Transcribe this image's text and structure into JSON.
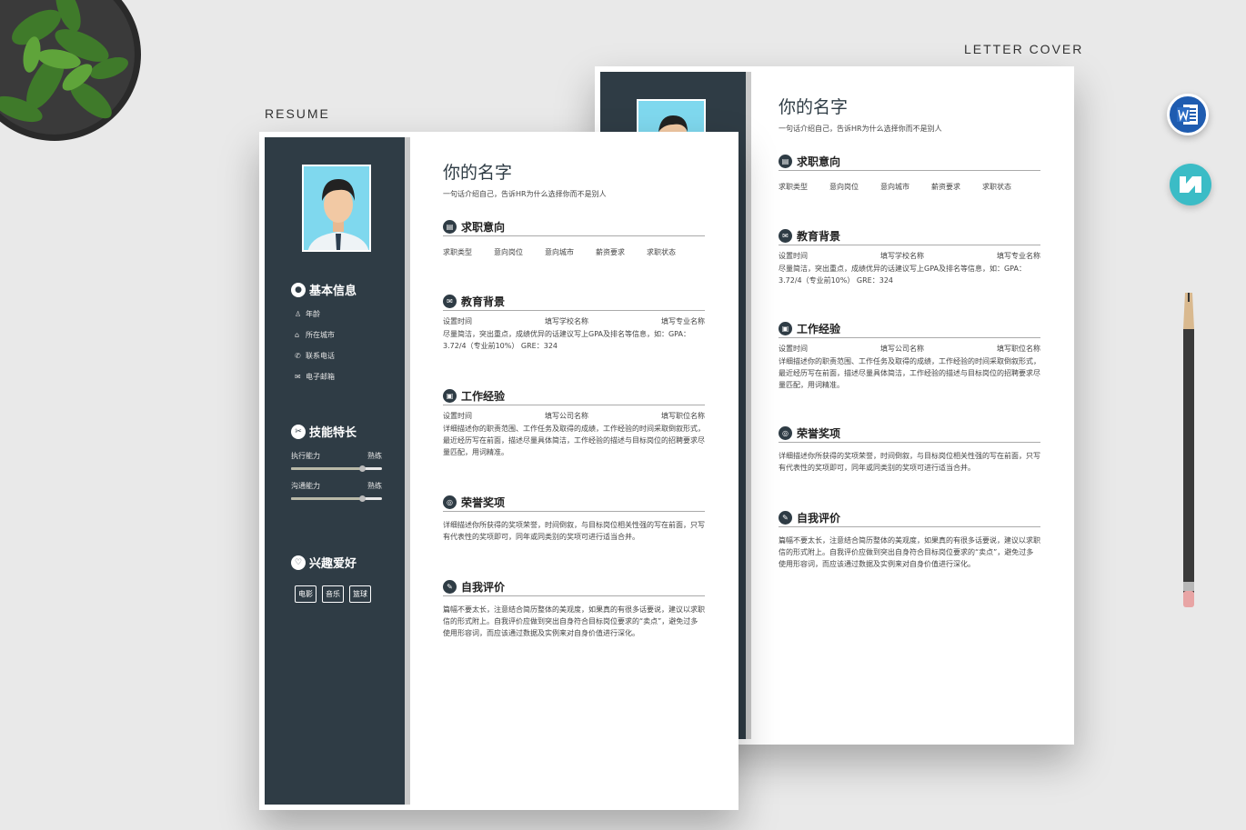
{
  "labels": {
    "letter_cover": "LETTER COVER",
    "resume": "RESUME"
  },
  "colors": {
    "sidebar": "#2f3c45",
    "avatar_bg": "#7fd8ee",
    "word": "#1f5cb0",
    "wps": "#3bbcc6"
  },
  "icons": {
    "word": "word-icon",
    "wps": "wps-icon"
  },
  "resume": {
    "name": "你的名字",
    "intro": "一句话介绍自己，告诉HR为什么选择你而不是别人",
    "sidebar": {
      "basic_title": "基本信息",
      "basic_items": [
        "年龄",
        "所在城市",
        "联系电话",
        "电子邮箱"
      ],
      "skills_title": "技能特长",
      "skills": [
        {
          "name": "执行能力",
          "level": "熟练",
          "value": 0.78
        },
        {
          "name": "沟通能力",
          "level": "熟练",
          "value": 0.78
        }
      ],
      "hobby_title": "兴趣爱好",
      "hobbies": [
        "电影",
        "音乐",
        "篮球"
      ]
    },
    "sections": {
      "intent": {
        "title": "求职意向",
        "fields": [
          "求职类型",
          "意向岗位",
          "意向城市",
          "薪资要求",
          "求职状态"
        ]
      },
      "edu": {
        "title": "教育背景",
        "cols": [
          "设置时间",
          "填写学校名称",
          "填写专业名称"
        ],
        "text": "尽量简洁，突出重点，成绩优异的话建议写上GPA及排名等信息，如：GPA：3.72/4（专业前10%） GRE：324"
      },
      "work": {
        "title": "工作经验",
        "cols": [
          "设置时间",
          "填写公司名称",
          "填写职位名称"
        ],
        "text": "详细描述你的职责范围、工作任务及取得的成绩，工作经验的时间采取倒叙形式，最近经历写在前面，描述尽量具体简洁，工作经验的描述与目标岗位的招聘要求尽量匹配，用词精准。"
      },
      "awards": {
        "title": "荣誉奖项",
        "text": "详细描述你所获得的奖项荣誉，时间倒叙，与目标岗位相关性强的写在前面，只写有代表性的奖项即可，同年或同类别的奖项可进行适当合并。"
      },
      "self": {
        "title": "自我评价",
        "text": "篇幅不要太长，注意结合简历整体的美观度，如果真的有很多话要说，建议以求职信的形式附上。自我评价应做到突出自身符合目标岗位要求的“卖点”，避免过多使用形容词，而应该通过数据及实例来对自身价值进行深化。"
      }
    }
  }
}
